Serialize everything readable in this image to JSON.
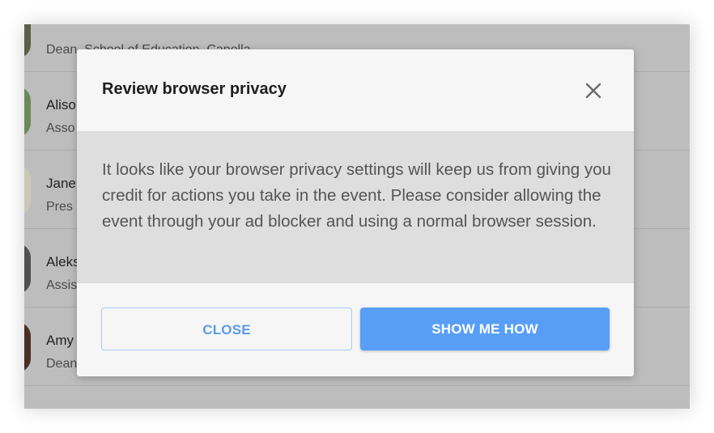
{
  "people": [
    {
      "name": "",
      "title": "Dean, School of Education, Capella"
    },
    {
      "name": "Aliso",
      "title": "Asso"
    },
    {
      "name": "Jane",
      "title": "Pres"
    },
    {
      "name": "Aleks",
      "title": "Assis"
    },
    {
      "name": "Amy",
      "title": "Dean"
    }
  ],
  "modal": {
    "title": "Review browser privacy",
    "close_icon": "close-icon",
    "body": "It looks like your browser privacy settings will keep us from giving you credit for actions you take in the event. Please consider allowing the event through your ad blocker and using a normal browser session.",
    "close_label": "CLOSE",
    "show_label": "SHOW ME HOW"
  },
  "colors": {
    "primary_button": "#589ef7",
    "secondary_text": "#5a9be8",
    "body_band": "#dedede",
    "overlay": "#bdbdbd"
  }
}
